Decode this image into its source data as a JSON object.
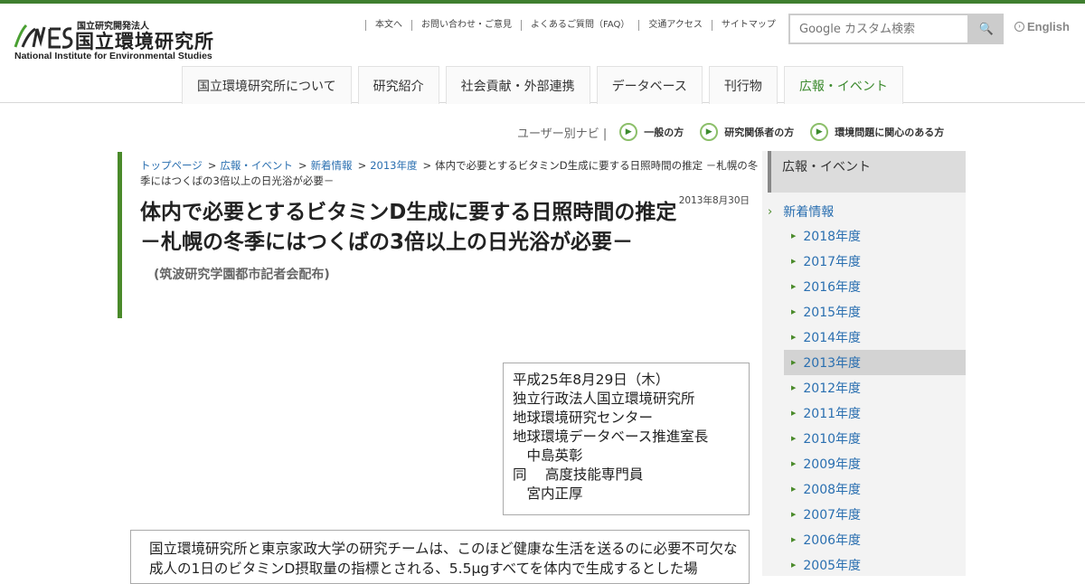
{
  "logo": {
    "org_type": "国立研究開発法人",
    "org_name": "国立環境研究所",
    "org_name_en": "National Institute for Environmental Studies"
  },
  "util_links": [
    "本文へ",
    "お問い合わせ・ご意見",
    "よくあるご質問（FAQ）",
    "交通アクセス",
    "サイトマップ"
  ],
  "search": {
    "placeholder": "Google カスタム検索",
    "button": "🔍"
  },
  "english": "English",
  "nav": [
    "国立環境研究所について",
    "研究紹介",
    "社会貢献・外部連携",
    "データベース",
    "刊行物",
    "広報・イベント"
  ],
  "user_navi": {
    "lead": "ユーザー別ナビ |",
    "items": [
      "一般の方",
      "研究関係者の方",
      "環境問題に関心のある方"
    ]
  },
  "breadcrumb": {
    "links": [
      "トップページ",
      "広報・イベント",
      "新着情報",
      "2013年度"
    ],
    "current": "体内で必要とするビタミンD生成に要する日照時間の推定 －札幌の冬季にはつくばの3倍以上の日光浴が必要－"
  },
  "article": {
    "date": "2013年8月30日",
    "title_line1": "体内で必要とするビタミンD生成に要する日照時間の推定",
    "title_line2": "－札幌の冬季にはつくばの3倍以上の日光浴が必要－",
    "subtitle": "(筑波研究学園都市記者会配布)",
    "info": [
      "平成25年8月29日（木）",
      "独立行政法人国立環境研究所",
      "地球環境研究センター",
      "地球環境データベース推進室長",
      "　中島英彰",
      "同　 高度技能専門員",
      "　宮内正厚"
    ],
    "body": "国立環境研究所と東京家政大学の研究チームは、このほど健康な生活を送るのに必要不可欠な成人の1日のビタミンD摂取量の指標とされる、5.5μgすべてを体内で生成するとした場"
  },
  "sidebar": {
    "head": "広報・イベント",
    "section": "新着情報",
    "years": [
      "2018年度",
      "2017年度",
      "2016年度",
      "2015年度",
      "2014年度",
      "2013年度",
      "2012年度",
      "2011年度",
      "2010年度",
      "2009年度",
      "2008年度",
      "2007年度",
      "2006年度",
      "2005年度"
    ],
    "current_year": "2013年度"
  },
  "colors": {
    "accent": "#3f7f2f",
    "link": "#2a6fb0"
  }
}
